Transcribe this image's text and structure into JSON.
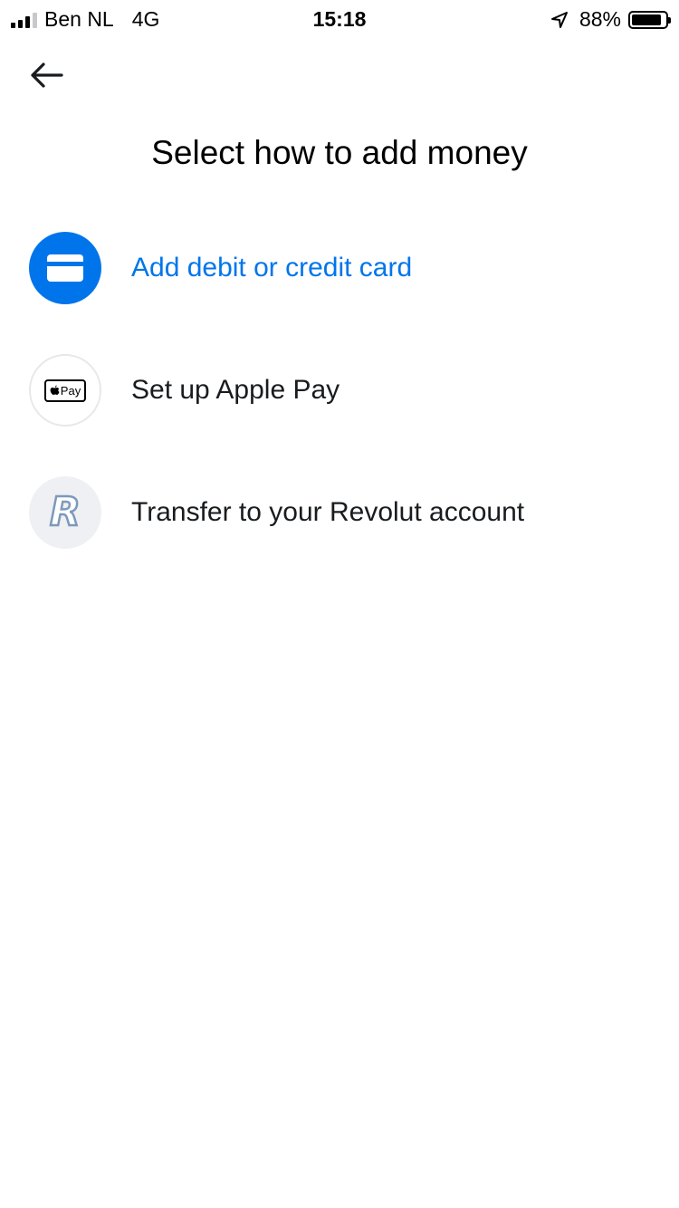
{
  "status_bar": {
    "carrier": "Ben NL",
    "network": "4G",
    "time": "15:18",
    "battery_percent": "88%",
    "battery_level": 0.88,
    "icons": [
      "signal-icon",
      "location-arrow-icon",
      "battery-icon"
    ]
  },
  "header": {
    "back_icon": "arrow-left-icon",
    "title": "Select how to add money"
  },
  "options": [
    {
      "label": "Add debit or credit card",
      "icon": "credit-card-icon",
      "color": "#0075eb"
    },
    {
      "label": "Set up Apple Pay",
      "icon": "apple-pay-icon",
      "badge_text": "Pay"
    },
    {
      "label": "Transfer to your Revolut account",
      "icon": "revolut-logo-icon",
      "logo_text": "R"
    }
  ],
  "colors": {
    "accent": "#0075eb",
    "text": "#191c1f",
    "revolut_logo": "#7d99bb"
  }
}
